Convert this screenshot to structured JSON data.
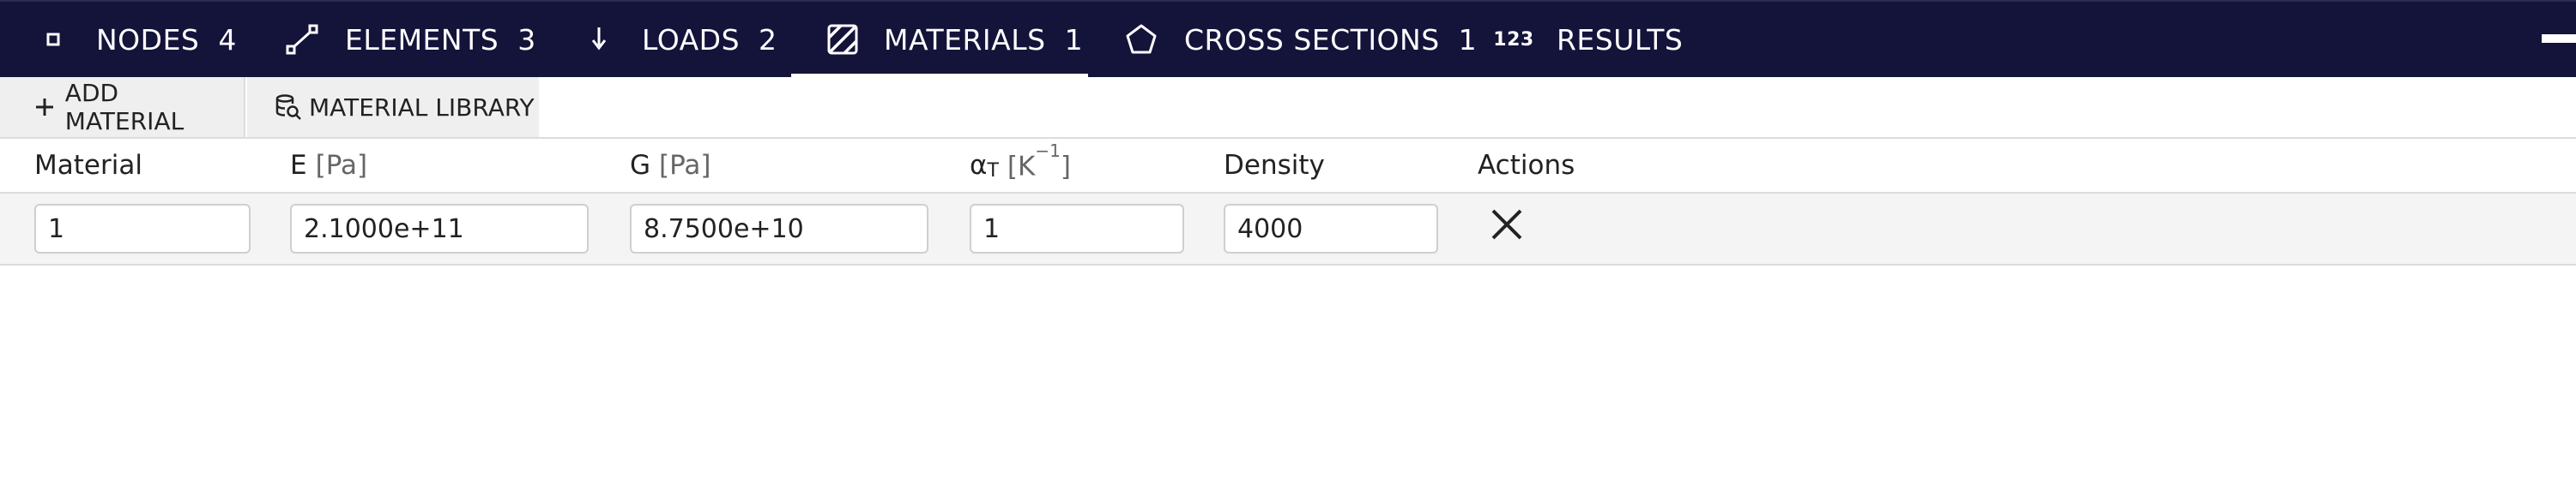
{
  "tabs": [
    {
      "label": "NODES",
      "count": "4",
      "icon": "node-square-icon"
    },
    {
      "label": "ELEMENTS",
      "count": "3",
      "icon": "element-line-icon"
    },
    {
      "label": "LOADS",
      "count": "2",
      "icon": "load-arrow-down-icon"
    },
    {
      "label": "MATERIALS",
      "count": "1",
      "icon": "material-hatch-icon",
      "active": true
    },
    {
      "label": "CROSS SECTIONS",
      "count": "1",
      "icon": "pentagon-icon"
    },
    {
      "label": "RESULTS",
      "count": "",
      "icon": "numbers-123-icon",
      "icon_text": "123"
    }
  ],
  "toolbar": {
    "add_material_label": "ADD MATERIAL",
    "material_library_label": "MATERIAL LIBRARY"
  },
  "table": {
    "headers": {
      "material": "Material",
      "e": "E",
      "e_unit": "[Pa]",
      "g": "G",
      "g_unit": "[Pa]",
      "alpha": "α",
      "alpha_sub": "T",
      "alpha_unit_open": "[K",
      "alpha_unit_sup": "−1",
      "alpha_unit_close": "]",
      "density": "Density",
      "actions": "Actions"
    },
    "rows": [
      {
        "material": "1",
        "e": "2.1000e+11",
        "g": "8.7500e+10",
        "alpha": "1",
        "density": "4000"
      }
    ]
  },
  "colors": {
    "tabbar_bg": "#14133a",
    "toolbar_btn_bg": "#efefef",
    "row_bg": "#f4f4f4"
  }
}
